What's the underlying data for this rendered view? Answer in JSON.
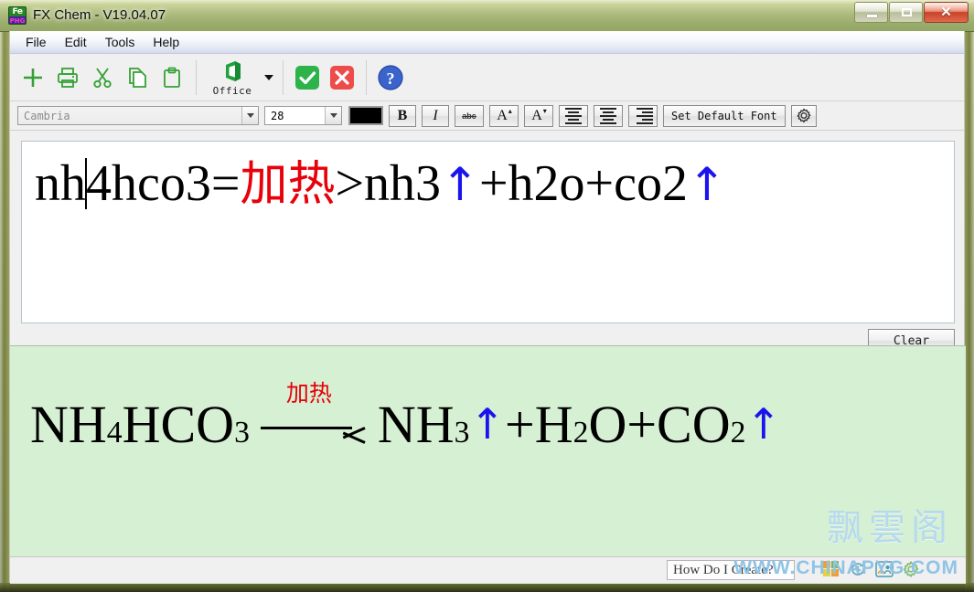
{
  "window": {
    "title": "FX Chem - V19.04.07",
    "app_icon": "fe-ion-icon",
    "controls": {
      "minimize": "minimize-button",
      "maximize": "maximize-button",
      "close_glyph": "✕"
    }
  },
  "menu": {
    "items": [
      {
        "label": "File",
        "name": "menu-file"
      },
      {
        "label": "Edit",
        "name": "menu-edit"
      },
      {
        "label": "Tools",
        "name": "menu-tools"
      },
      {
        "label": "Help",
        "name": "menu-help"
      }
    ]
  },
  "toolbar": {
    "buttons": [
      {
        "name": "new-icon",
        "glyph": "+"
      },
      {
        "name": "print-icon",
        "glyph": "print"
      },
      {
        "name": "cut-icon",
        "glyph": "scissors"
      },
      {
        "name": "copy-icon",
        "glyph": "copy"
      },
      {
        "name": "paste-icon",
        "glyph": "clipboard"
      }
    ],
    "office": {
      "label": "Office",
      "name": "office-export-button"
    },
    "confirm": {
      "name": "confirm-icon",
      "glyph": "✔",
      "color": "#2db34a"
    },
    "cancel": {
      "name": "cancel-icon",
      "glyph": "✕",
      "color": "#ee4b4b"
    },
    "help": {
      "name": "help-icon",
      "glyph": "?",
      "color": "#2e58c8"
    }
  },
  "format_bar": {
    "font_name": "Cambria",
    "font_size": "28",
    "text_color": "#000000",
    "bold": "B",
    "italic": "I",
    "strikethrough": "abc",
    "grow_font": "A",
    "shrink_font": "A",
    "align_left": "align-left",
    "align_center": "align-center",
    "align_right": "align-right",
    "set_default_font": "Set Default Font",
    "settings": "gear-icon"
  },
  "editor": {
    "segments": [
      {
        "text": "nh",
        "color": "black"
      },
      {
        "text": "caret",
        "color": "caret"
      },
      {
        "text": "4hco3=",
        "color": "black"
      },
      {
        "text": "加热",
        "color": "red"
      },
      {
        "text": ">nh3",
        "color": "black"
      },
      {
        "text": "↑",
        "color": "blue"
      },
      {
        "text": "+h2o+co2",
        "color": "black"
      },
      {
        "text": "↑",
        "color": "blue"
      }
    ],
    "raw_text": "nh4hco3=加热>nh3↑+h2o+co2↑",
    "clear_button": "Clear"
  },
  "preview": {
    "reactant": {
      "main1": "NH",
      "sub1": "4",
      "main2": "HCO",
      "sub2": "3"
    },
    "condition": "加热",
    "products": [
      {
        "main": "NH",
        "sub": "3",
        "arrow": "↑"
      },
      {
        "plus": "+",
        "main": "H",
        "sub": "2",
        "tail": "O"
      },
      {
        "plus": "+",
        "main": "CO",
        "sub": "2",
        "arrow": "↑"
      }
    ],
    "rendered_equation": "NH4HCO3 —加热→ NH3↑+H2O+CO2↑",
    "colors": {
      "background": "#d5f0d2",
      "condition": "#e8000a",
      "arrow_up": "#1a13ef"
    }
  },
  "watermark": {
    "chinese": "飘雲阁",
    "url": "WWW.CHINAPYG.COM"
  },
  "status_bar": {
    "hint": "How Do I Create?",
    "icons": [
      {
        "name": "color-blocks-icon"
      },
      {
        "name": "history-clock-icon"
      },
      {
        "name": "group-users-icon"
      },
      {
        "name": "settings-gear-icon"
      }
    ]
  }
}
